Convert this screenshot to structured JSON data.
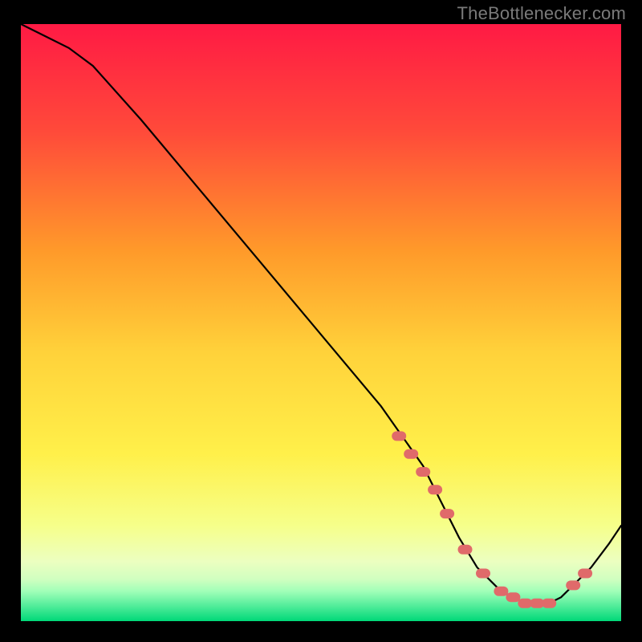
{
  "attribution": "TheBottlenecker.com",
  "colors": {
    "gradient_top": "#ff1a44",
    "gradient_mid_top": "#ff7a2a",
    "gradient_mid": "#ffe23a",
    "gradient_mid_bottom": "#f6ff7a",
    "gradient_bottom_band1": "#d6ffb0",
    "gradient_bottom_band2": "#7bffb2",
    "gradient_bottom_band3": "#00e07a",
    "line": "#000000",
    "marker_fill": "#e06a6a",
    "marker_stroke": "#d24f4f"
  },
  "chart_data": {
    "type": "line",
    "title": "",
    "xlabel": "",
    "ylabel": "",
    "xlim": [
      0,
      100
    ],
    "ylim": [
      0,
      100
    ],
    "grid": false,
    "series": [
      {
        "name": "curve",
        "x": [
          0,
          4,
          8,
          12,
          20,
          30,
          40,
          50,
          60,
          67,
          70,
          73,
          76,
          80,
          84,
          88,
          90,
          92,
          95,
          98,
          100
        ],
        "y": [
          100,
          98,
          96,
          93,
          84,
          72,
          60,
          48,
          36,
          26,
          20,
          14,
          9,
          5,
          3,
          3,
          4,
          6,
          9,
          13,
          16
        ]
      }
    ],
    "markers": {
      "name": "dots-on-curve",
      "x": [
        63,
        65,
        67,
        69,
        71,
        74,
        77,
        80,
        82,
        84,
        86,
        88,
        92,
        94
      ],
      "y": [
        31,
        28,
        25,
        22,
        18,
        12,
        8,
        5,
        4,
        3,
        3,
        3,
        6,
        8
      ]
    }
  }
}
